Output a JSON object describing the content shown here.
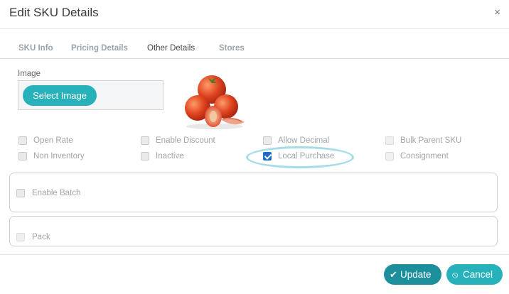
{
  "modal": {
    "title": "Edit SKU Details",
    "close_glyph": "×"
  },
  "tabs": [
    {
      "label": "SKU Info",
      "active": false
    },
    {
      "label": "Pricing Details",
      "active": false
    },
    {
      "label": "Other Details",
      "active": true
    },
    {
      "label": "Stores",
      "active": false
    }
  ],
  "image_section": {
    "label": "Image",
    "select_button": "Select Image",
    "preview": "tomatoes"
  },
  "options": {
    "open_rate": {
      "label": "Open Rate",
      "checked": false
    },
    "enable_discount": {
      "label": "Enable Discount",
      "checked": false
    },
    "allow_decimal": {
      "label": "Allow Decimal",
      "checked": false
    },
    "bulk_parent_sku": {
      "label": "Bulk Parent SKU",
      "checked": false,
      "disabled": true
    },
    "non_inventory": {
      "label": "Non Inventory",
      "checked": false
    },
    "inactive": {
      "label": "Inactive",
      "checked": false
    },
    "local_purchase": {
      "label": "Local Purchase",
      "checked": true
    },
    "consignment": {
      "label": "Consignment",
      "checked": false,
      "disabled": true
    }
  },
  "batch_section": {
    "label": "Enable Batch",
    "checked": false
  },
  "pack_section": {
    "label": "Pack",
    "checked": false,
    "disabled": true
  },
  "footer": {
    "update_label": "Update",
    "cancel_label": "Cancel"
  },
  "colors": {
    "accent": "#27b1bb",
    "accent_dark": "#1b8f9b",
    "checkbox_checked": "#1c6ec4",
    "highlight": "#a6dce8"
  }
}
